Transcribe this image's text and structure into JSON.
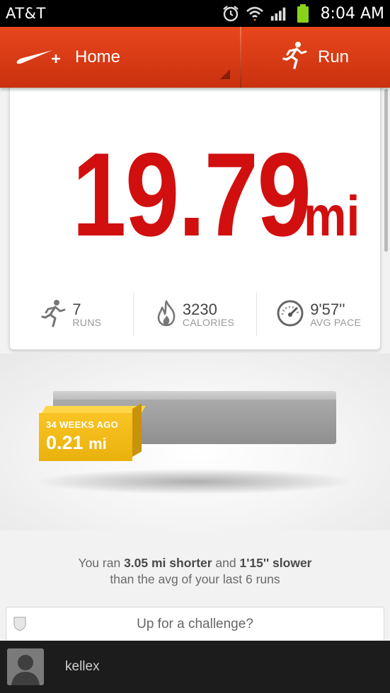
{
  "status_bar": {
    "carrier": "AT&T",
    "time": "8:04 AM",
    "icons": [
      "alarm-icon",
      "wifi-icon",
      "signal-icon",
      "battery-icon"
    ]
  },
  "action_bar": {
    "home_label": "Home",
    "run_label": "Run",
    "logo_plus": "+"
  },
  "summary": {
    "distance_value": "19.79",
    "distance_unit": "mi",
    "stats": [
      {
        "value": "7",
        "label": "RUNS",
        "icon": "runner-icon"
      },
      {
        "value": "3230",
        "label": "CALORIES",
        "icon": "flame-icon"
      },
      {
        "value": "9'57''",
        "label": "AVG PACE",
        "icon": "speedometer-icon"
      }
    ]
  },
  "comparison": {
    "weeks_ago": "34 WEEKS AGO",
    "run_distance_value": "0.21",
    "run_distance_unit": "mi",
    "line1_prefix": "You ran ",
    "line1_distance": "3.05 mi shorter",
    "line1_mid": " and ",
    "line1_pace": "1'15'' slower",
    "line2": "than the avg of your last 6 runs"
  },
  "challenge": {
    "label": "Up for a challenge?"
  },
  "user": {
    "name": "kellex"
  },
  "colors": {
    "brand_orange": "#d93a14",
    "distance_red": "#d10f0f",
    "run_block_yellow": "#f4bb1a"
  }
}
